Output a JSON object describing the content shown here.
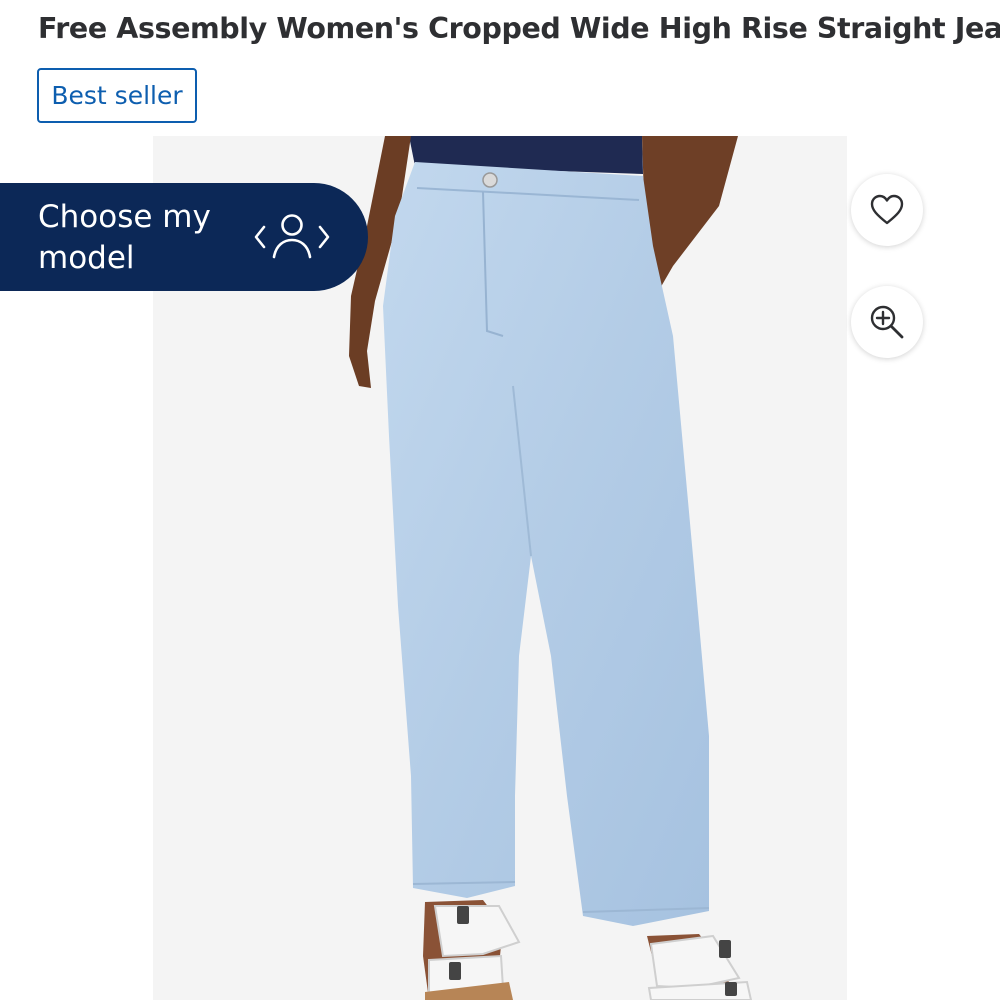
{
  "product": {
    "title": "Free Assembly Women's Cropped Wide High Rise Straight Jeans",
    "badge": "Best seller"
  },
  "model_selector": {
    "label": "Choose my model",
    "icon": "person-switch-icon"
  },
  "actions": {
    "favorite_icon": "heart-icon",
    "zoom_icon": "zoom-in-icon"
  },
  "colors": {
    "title_text": "#2e2f32",
    "brand_blue": "#0d5eaf",
    "chip_background": "#0c2857",
    "denim": "#b7d0e8",
    "image_background": "#f4f4f4"
  }
}
